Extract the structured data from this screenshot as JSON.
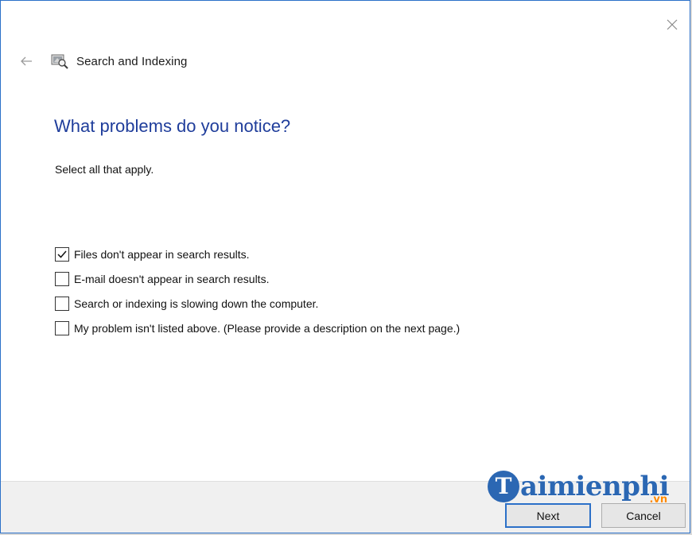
{
  "window": {
    "title": "Search and Indexing",
    "close_icon": "close-icon",
    "back_icon": "back-arrow-icon",
    "app_icon": "search-indexing-icon"
  },
  "content": {
    "heading": "What problems do you notice?",
    "instruction": "Select all that apply.",
    "options": [
      {
        "label": "Files don't appear in search results.",
        "checked": true
      },
      {
        "label": "E-mail doesn't appear in search results.",
        "checked": false
      },
      {
        "label": "Search or indexing is slowing down the computer.",
        "checked": false
      },
      {
        "label": "My problem isn't listed above. (Please provide a description on the next page.)",
        "checked": false
      }
    ]
  },
  "footer": {
    "next_label": "Next",
    "cancel_label": "Cancel"
  },
  "watermark": {
    "logo_letter": "T",
    "text": "aimienphi",
    "suffix": ".vn"
  },
  "colors": {
    "accent": "#2B70C8",
    "heading": "#1F3D9B",
    "footer_bg": "#F0F0F0",
    "watermark_blue": "#2B67B3",
    "watermark_orange": "#FF8A00"
  }
}
